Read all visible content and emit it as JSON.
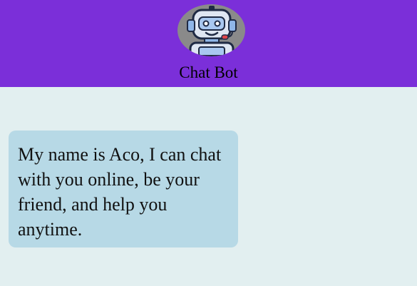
{
  "header": {
    "title": "Chat Bot",
    "avatar_icon": "robot-icon",
    "background_color": "#7b2fd9"
  },
  "chat": {
    "background_color": "#e2eff0",
    "messages": [
      {
        "sender": "bot",
        "text": "My name is Aco, I can chat with you online, be your friend, and help you anytime.",
        "bubble_color": "#b7d9e6"
      }
    ]
  }
}
